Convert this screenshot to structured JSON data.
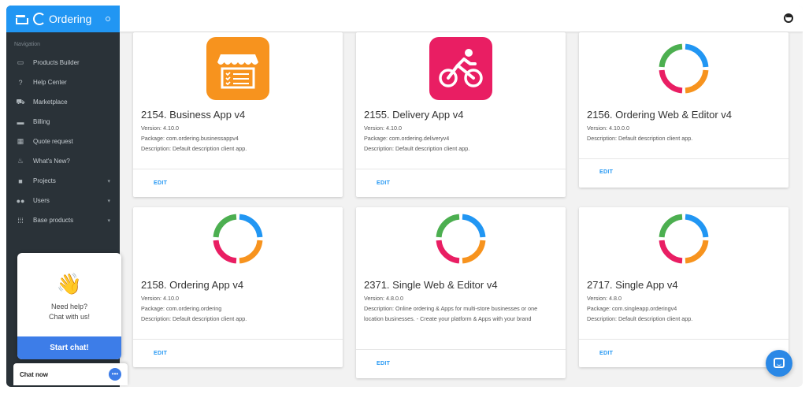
{
  "app": {
    "brand": "Ordering"
  },
  "sidebar": {
    "section_label": "Navigation",
    "items": [
      {
        "label": "Products Builder",
        "icon": "devices-icon",
        "has_caret": false
      },
      {
        "label": "Help Center",
        "icon": "help-icon",
        "has_caret": false
      },
      {
        "label": "Marketplace",
        "icon": "cart-icon",
        "has_caret": false
      },
      {
        "label": "Billing",
        "icon": "credit-card-icon",
        "has_caret": false
      },
      {
        "label": "Quote request",
        "icon": "calculator-icon",
        "has_caret": false
      },
      {
        "label": "What's New?",
        "icon": "fire-icon",
        "has_caret": false
      },
      {
        "label": "Projects",
        "icon": "briefcase-icon",
        "has_caret": true
      },
      {
        "label": "Users",
        "icon": "people-icon",
        "has_caret": true
      },
      {
        "label": "Base products",
        "icon": "grid-icon",
        "has_caret": true
      }
    ]
  },
  "cards": [
    {
      "title": "2154. Business App v4",
      "version": "Version: 4.10.0",
      "package": "Package: com.ordering.businessappv4",
      "description": "Description: Default description client app.",
      "edit_label": "EDIT",
      "icon": "store-icon",
      "icon_color": "#f7931e"
    },
    {
      "title": "2155. Delivery App v4",
      "version": "Version: 4.10.0",
      "package": "Package: com.ordering.deliveryv4",
      "description": "Description: Default description client app.",
      "edit_label": "EDIT",
      "icon": "bike-icon",
      "icon_color": "#e91e63"
    },
    {
      "title": "2156. Ordering Web & Editor v4",
      "version": "Version: 4.10.0.0",
      "package": "",
      "description": "Description: Default description client app.",
      "edit_label": "EDIT",
      "icon": "ordering-ring-icon",
      "icon_color": ""
    },
    {
      "title": "2158. Ordering App v4",
      "version": "Version: 4.10.0",
      "package": "Package: com.ordering.ordering",
      "description": "Description: Default description client app.",
      "edit_label": "EDIT",
      "icon": "ordering-ring-icon",
      "icon_color": ""
    },
    {
      "title": "2371. Single Web & Editor v4",
      "version": "Version: 4.8.0.0",
      "package": "",
      "description": "Description: Online ordering & Apps for multi-store businesses or one location businesses. - Create your platform & Apps with your brand",
      "edit_label": "EDIT",
      "icon": "ordering-ring-icon",
      "icon_color": ""
    },
    {
      "title": "2717. Single App v4",
      "version": "Version: 4.8.0",
      "package": "Package: com.singleapp.orderingv4",
      "description": "Description: Default description client app.",
      "edit_label": "EDIT",
      "icon": "ordering-ring-icon",
      "icon_color": ""
    }
  ],
  "ring_colors": {
    "top_right": "#2196f3",
    "bottom_right": "#f7931e",
    "bottom_left": "#e91e63",
    "top_left": "#4caf50"
  },
  "chat": {
    "emoji": "👋",
    "help_line1": "Need help?",
    "help_line2": "Chat with us!",
    "start_label": "Start chat!",
    "chat_now_label": "Chat now"
  }
}
